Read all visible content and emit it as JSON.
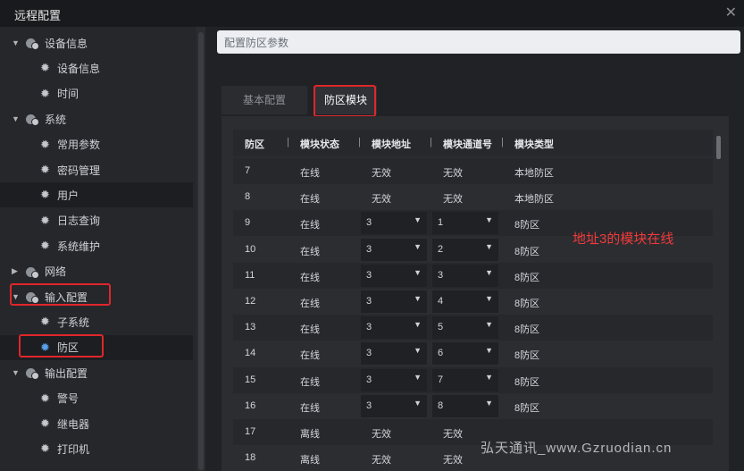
{
  "window": {
    "title": "远程配置",
    "close_glyph": "✕"
  },
  "sidebar": {
    "groups": [
      {
        "label": "设备信息",
        "expanded": true,
        "items": [
          "设备信息",
          "时间"
        ]
      },
      {
        "label": "系统",
        "expanded": true,
        "items": [
          "常用参数",
          "密码管理",
          "用户",
          "日志查询",
          "系统维护"
        ]
      },
      {
        "label": "网络",
        "expanded": false,
        "items": []
      },
      {
        "label": "输入配置",
        "expanded": true,
        "items": [
          "子系统",
          "防区"
        ]
      },
      {
        "label": "输出配置",
        "expanded": true,
        "items": [
          "警号",
          "继电器",
          "打印机"
        ]
      }
    ],
    "highlighted_item": "用户",
    "selected_item": "防区"
  },
  "main": {
    "header_title": "配置防区参数",
    "tabs": [
      {
        "label": "基本配置",
        "active": false
      },
      {
        "label": "防区模块",
        "active": true
      }
    ]
  },
  "table": {
    "columns": [
      "防区",
      "模块状态",
      "模块地址",
      "模块通道号",
      "模块类型"
    ],
    "separator": "|",
    "rows": [
      {
        "zone": "7",
        "status": "在线",
        "address": "无效",
        "channel": "无效",
        "type": "本地防区",
        "editable": false
      },
      {
        "zone": "8",
        "status": "在线",
        "address": "无效",
        "channel": "无效",
        "type": "本地防区",
        "editable": false
      },
      {
        "zone": "9",
        "status": "在线",
        "address": "3",
        "channel": "1",
        "type": "8防区",
        "editable": true
      },
      {
        "zone": "10",
        "status": "在线",
        "address": "3",
        "channel": "2",
        "type": "8防区",
        "editable": true
      },
      {
        "zone": "11",
        "status": "在线",
        "address": "3",
        "channel": "3",
        "type": "8防区",
        "editable": true
      },
      {
        "zone": "12",
        "status": "在线",
        "address": "3",
        "channel": "4",
        "type": "8防区",
        "editable": true
      },
      {
        "zone": "13",
        "status": "在线",
        "address": "3",
        "channel": "5",
        "type": "8防区",
        "editable": true
      },
      {
        "zone": "14",
        "status": "在线",
        "address": "3",
        "channel": "6",
        "type": "8防区",
        "editable": true
      },
      {
        "zone": "15",
        "status": "在线",
        "address": "3",
        "channel": "7",
        "type": "8防区",
        "editable": true
      },
      {
        "zone": "16",
        "status": "在线",
        "address": "3",
        "channel": "8",
        "type": "8防区",
        "editable": true
      },
      {
        "zone": "17",
        "status": "离线",
        "address": "无效",
        "channel": "无效",
        "type": "",
        "editable": false
      },
      {
        "zone": "18",
        "status": "离线",
        "address": "无效",
        "channel": "无效",
        "type": "",
        "editable": false
      }
    ]
  },
  "annotation": {
    "text": "地址3的模块在线",
    "color": "#f03a3a"
  },
  "watermark": {
    "text": "弘天通讯_www.Gzruodian.cn"
  },
  "icons": {
    "tree_expanded": "▼",
    "tree_collapsed": "▶",
    "gear": "✹",
    "dropdown": "▼"
  },
  "colors": {
    "highlight_box": "#e0262a",
    "background": "#1d1f23",
    "header_box": "#eceef1"
  }
}
